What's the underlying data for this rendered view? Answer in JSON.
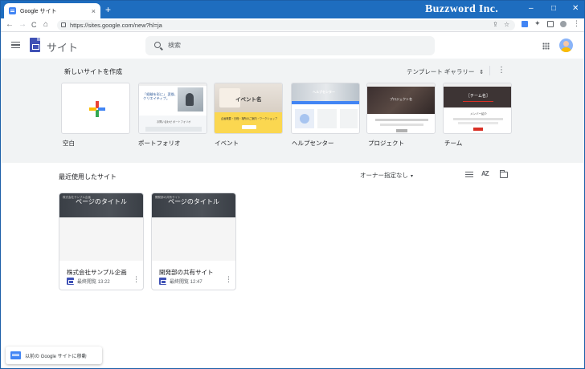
{
  "browser": {
    "tab_title": "Google サイト",
    "tab_close": "×",
    "new_tab": "+",
    "brand": "Buzzword Inc.",
    "window_controls": [
      "–",
      "□",
      "✕"
    ],
    "url": "https://sites.google.com/new?hl=ja",
    "nav": [
      "←",
      "→",
      "C",
      "⌂"
    ]
  },
  "header": {
    "app_title": "サイト",
    "search_placeholder": "検索"
  },
  "gallery": {
    "title": "新しいサイトを作成",
    "toggle_label": "テンプレート ギャラリー",
    "toggle_chevron": "⌃",
    "more": "⋮",
    "templates": [
      {
        "label": "空白"
      },
      {
        "label": "ポートフォリオ",
        "text": "「経験を形に」 変換、信頼、\nクリエイティブ。",
        "subtext": "お問い合わせ ポートフォリオ"
      },
      {
        "label": "イベント",
        "text": "イベント名",
        "subtext": "企画概要・日程・場所のご案内・ワークショップ"
      },
      {
        "label": "ヘルプセンター",
        "text": "ヘルプセンター"
      },
      {
        "label": "プロジェクト",
        "text": "プロジェクト名"
      },
      {
        "label": "チーム",
        "text": "［チーム名］",
        "subtext": "メンバー紹介"
      }
    ]
  },
  "recent": {
    "title": "最近使用したサイト",
    "owner_filter": "オーナー指定なし",
    "owner_caret": "▾",
    "sort_label": "AZ",
    "sites": [
      {
        "thumb_title": "ページのタイトル",
        "thumb_small": "株式会社サンプル企画",
        "name": "株式会社サンプル企画",
        "meta": "最終閲覧 13:22"
      },
      {
        "thumb_title": "ページのタイトル",
        "thumb_small": "開発部の共有サイト",
        "name": "開発部の共有サイト",
        "meta": "最終閲覧 12:47"
      }
    ]
  },
  "legacy": {
    "label": "以前の Google サイトに移動"
  },
  "colors": {
    "chrome_blue": "#1e6dbf",
    "sites_indigo": "#3f51b5",
    "gallery_bg": "#f1f3f4",
    "event_yellow": "#fbd750"
  }
}
